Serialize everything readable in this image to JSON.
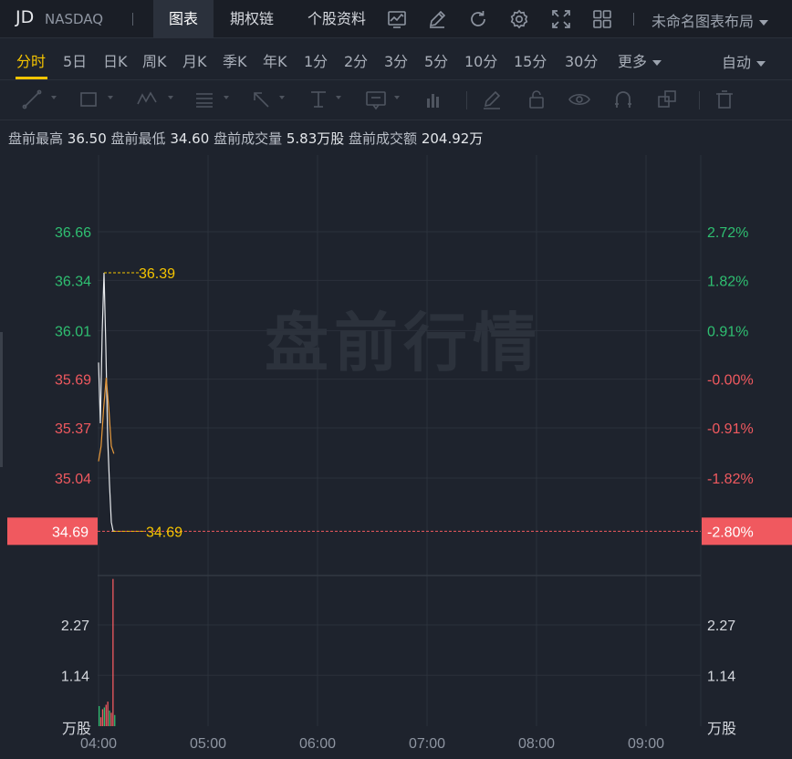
{
  "header": {
    "symbol": "JD",
    "exchange": "NASDAQ",
    "tabs": [
      {
        "label": "图表",
        "active": true
      },
      {
        "label": "期权链"
      },
      {
        "label": "个股资料"
      }
    ],
    "layout_label": "未命名图表布局",
    "icons": [
      "indicator-icon",
      "draw-pen-icon",
      "refresh-icon",
      "settings-gear-icon",
      "fullscreen-icon",
      "grid-layout-icon"
    ]
  },
  "periods": {
    "items": [
      "分时",
      "5日",
      "日K",
      "周K",
      "月K",
      "季K",
      "年K",
      "1分",
      "2分",
      "3分",
      "5分",
      "10分",
      "15分",
      "30分",
      "更多"
    ],
    "active": "分时",
    "auto_label": "自动"
  },
  "tools": [
    "trendline-icon",
    "rectangle-icon",
    "wave-icon",
    "fib-icon",
    "arrow-icon",
    "price-range-icon",
    "text-note-icon",
    "position-icon",
    "brush-icon",
    "lock-icon",
    "eye-icon",
    "magnet-icon",
    "copy-icon",
    "trash-icon"
  ],
  "stats": [
    {
      "label": "盘前最高",
      "value": "36.50"
    },
    {
      "label": "盘前最低",
      "value": "34.60"
    },
    {
      "label": "盘前成交量",
      "value": "5.83万股"
    },
    {
      "label": "盘前成交额",
      "value": "204.92万"
    }
  ],
  "watermark": "盘前行情",
  "colors": {
    "up": "#2fbf71",
    "down": "#f0595f",
    "price_line": "#e8eaed",
    "avg_line": "#e89a3c",
    "accent": "#f5c400",
    "current_tag": "#f0595f"
  },
  "chart_data": {
    "type": "line",
    "price_axis_left": [
      "36.66",
      "36.34",
      "36.01",
      "35.69",
      "35.37",
      "35.04"
    ],
    "price_axis_right": [
      "2.72%",
      "1.82%",
      "0.91%",
      "-0.00%",
      "-0.91%",
      "-1.82%"
    ],
    "price_values": [
      36.66,
      36.34,
      36.01,
      35.69,
      35.37,
      35.04
    ],
    "current_price": "34.69",
    "current_change": "-2.80%",
    "high_label": "36.39",
    "low_label": "34.69",
    "price_series_x_min": [
      0,
      1,
      2,
      3,
      4,
      5,
      6,
      7,
      8,
      9
    ],
    "price_series_y": [
      35.8,
      35.4,
      36.0,
      36.39,
      35.9,
      35.3,
      35.0,
      34.75,
      34.69,
      34.69
    ],
    "avg_series_y": [
      35.15,
      35.25,
      35.5,
      35.7,
      35.5,
      35.25,
      35.2
    ],
    "volume_axis": [
      "2.27",
      "1.14"
    ],
    "volume_unit": "万股",
    "volume_values": [
      0.45,
      0.2,
      0.38,
      0.42,
      0.48,
      0.55,
      0.35,
      0.3,
      3.3,
      0.25
    ],
    "x_ticks": [
      "04:00",
      "05:00",
      "06:00",
      "07:00",
      "08:00",
      "09:00"
    ]
  }
}
